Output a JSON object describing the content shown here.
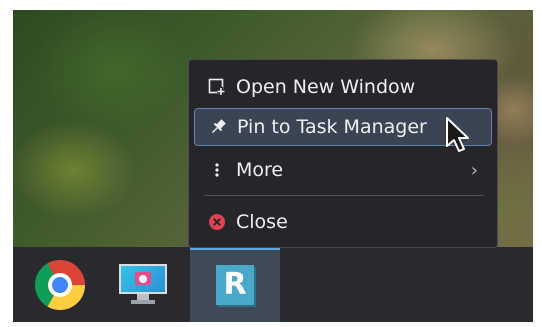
{
  "menu": {
    "items": [
      {
        "label": "Open New Window",
        "icon": "new-window-icon"
      },
      {
        "label": "Pin to Task Manager",
        "icon": "pin-icon",
        "highlighted": true
      },
      {
        "label": "More",
        "icon": "more-vertical-icon",
        "submenu_indicator": "›"
      },
      {
        "label": "Close",
        "icon": "close-icon"
      }
    ]
  },
  "taskbar": {
    "apps": [
      {
        "name": "chrome",
        "icon": "chrome-icon"
      },
      {
        "name": "screenshot",
        "icon": "screenshot-tool-icon"
      },
      {
        "name": "r-app",
        "icon": "r-app-icon",
        "letter": "R",
        "active": true
      }
    ]
  },
  "colors": {
    "menu_bg": "#26262a",
    "highlight_bg": "#3a4452",
    "highlight_border": "#5d86b0",
    "close_red": "#e0434e",
    "taskbar_bg": "#2a2a2e",
    "active_indicator": "#5aa9e6"
  }
}
